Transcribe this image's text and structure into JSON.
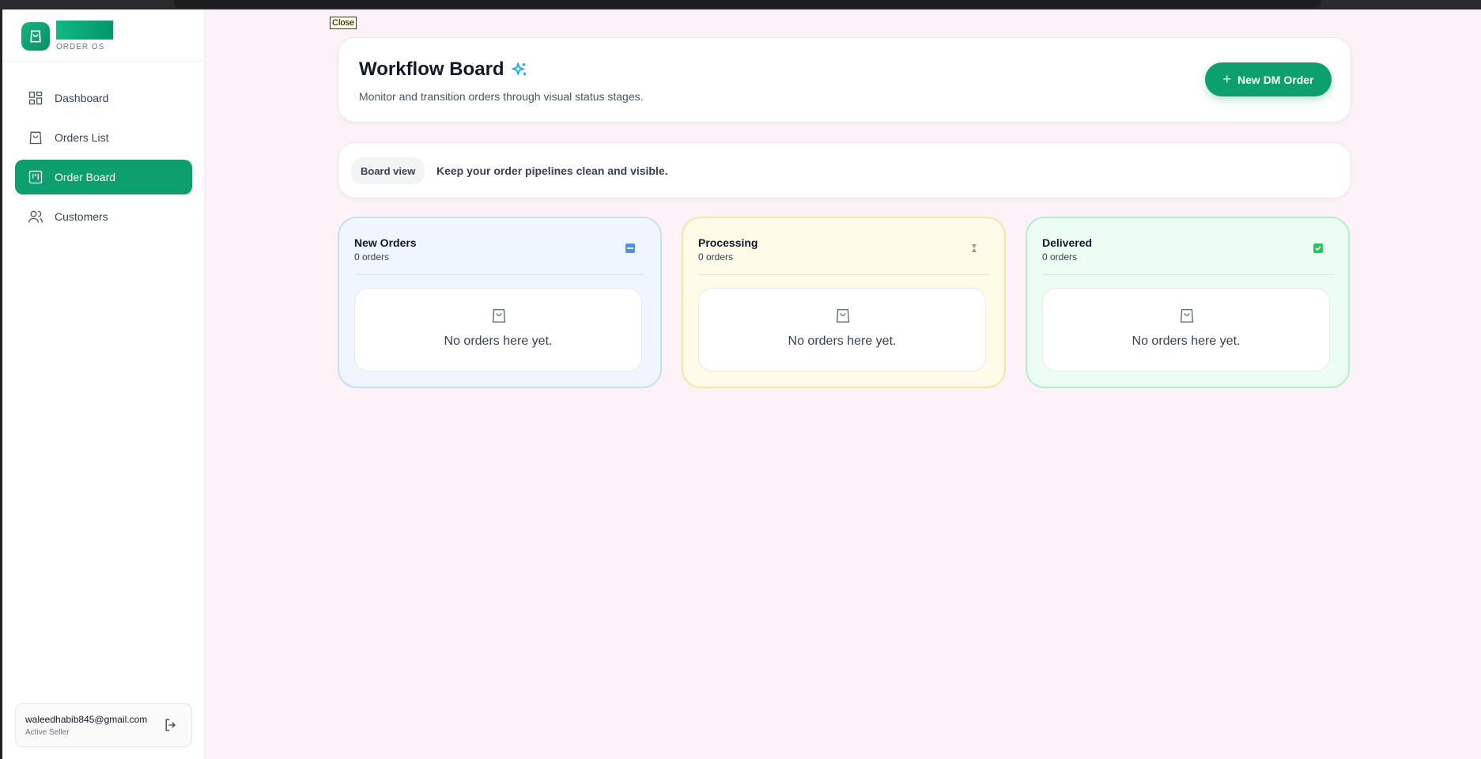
{
  "brand": {
    "subtitle": "ORDER OS",
    "accent": "#0d9f6e"
  },
  "close_tooltip": "Close",
  "sidebar": {
    "items": [
      {
        "label": "Dashboard",
        "icon": "grid-icon",
        "active": false
      },
      {
        "label": "Orders List",
        "icon": "bag-icon",
        "active": false
      },
      {
        "label": "Order Board",
        "icon": "kanban-icon",
        "active": true
      },
      {
        "label": "Customers",
        "icon": "users-icon",
        "active": false
      }
    ],
    "user": {
      "email": "waleedhabib845@gmail.com",
      "role": "Active Seller"
    }
  },
  "header": {
    "title": "Workflow Board",
    "subtitle": "Monitor and transition orders through visual status stages.",
    "new_button": "New DM Order"
  },
  "view_bar": {
    "pill": "Board view",
    "text": "Keep your order pipelines clean and visible."
  },
  "columns": [
    {
      "title": "New Orders",
      "count": "0 orders",
      "empty": "No orders here yet.",
      "icon": "new-icon",
      "color": "#eff6ff"
    },
    {
      "title": "Processing",
      "count": "0 orders",
      "empty": "No orders here yet.",
      "icon": "hourglass-icon",
      "color": "#fefbe8"
    },
    {
      "title": "Delivered",
      "count": "0 orders",
      "empty": "No orders here yet.",
      "icon": "check-icon",
      "color": "#ecfdf3"
    }
  ]
}
